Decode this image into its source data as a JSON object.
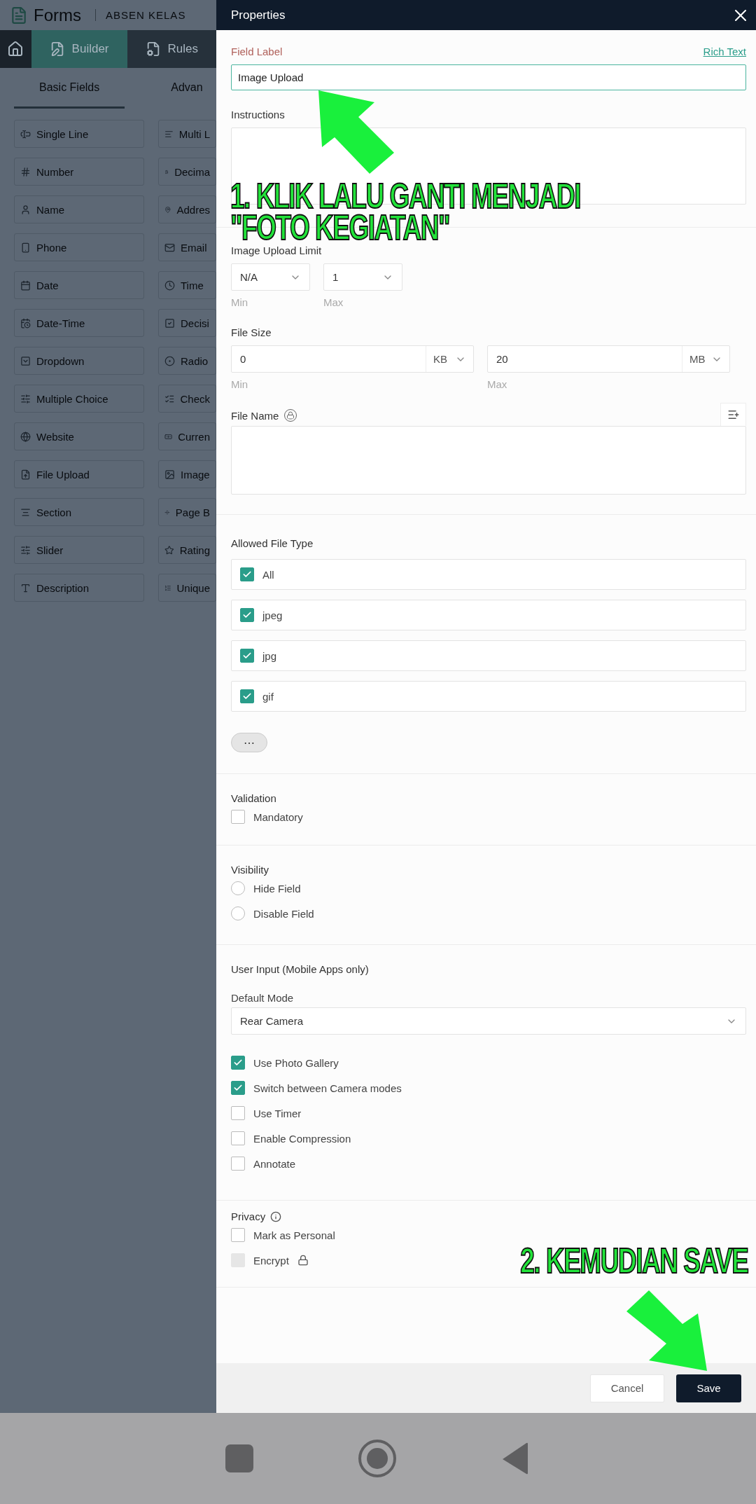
{
  "app_bar": {
    "title": "Forms",
    "form_name": "ABSEN KELAS"
  },
  "nav_tabs": [
    {
      "label": "Builder",
      "selected": true
    },
    {
      "label": "Rules",
      "selected": false
    }
  ],
  "field_tabs": [
    {
      "label": "Basic Fields",
      "selected": true
    },
    {
      "label": "Advan",
      "selected": false
    }
  ],
  "field_types": [
    {
      "label": "Single Line"
    },
    {
      "label": "Multi L"
    },
    {
      "label": "Number"
    },
    {
      "label": "Decima"
    },
    {
      "label": "Name"
    },
    {
      "label": "Addres"
    },
    {
      "label": "Phone"
    },
    {
      "label": "Email"
    },
    {
      "label": "Date"
    },
    {
      "label": "Time"
    },
    {
      "label": "Date-Time"
    },
    {
      "label": "Decisi"
    },
    {
      "label": "Dropdown"
    },
    {
      "label": "Radio"
    },
    {
      "label": "Multiple Choice"
    },
    {
      "label": "Check"
    },
    {
      "label": "Website"
    },
    {
      "label": "Curren"
    },
    {
      "label": "File Upload"
    },
    {
      "label": "Image"
    },
    {
      "label": "Section"
    },
    {
      "label": "Page B"
    },
    {
      "label": "Slider"
    },
    {
      "label": "Rating"
    },
    {
      "label": "Description"
    },
    {
      "label": "Unique"
    }
  ],
  "properties": {
    "title": "Properties",
    "field_label": {
      "label": "Field Label",
      "link": "Rich Text",
      "value": "Image Upload"
    },
    "instructions": {
      "label": "Instructions"
    },
    "upload_limit": {
      "label": "Image Upload Limit",
      "min": {
        "value": "N/A",
        "caption": "Min"
      },
      "max": {
        "value": "1",
        "caption": "Max"
      }
    },
    "file_size": {
      "label": "File Size",
      "min": {
        "value": "0",
        "unit": "KB",
        "caption": "Min"
      },
      "max": {
        "value": "20",
        "unit": "MB",
        "caption": "Max"
      }
    },
    "file_name": {
      "label": "File Name"
    },
    "allowed_types": {
      "label": "Allowed File Type",
      "more": "⋯",
      "items": [
        {
          "label": "All",
          "checked": true
        },
        {
          "label": "jpeg",
          "checked": true
        },
        {
          "label": "jpg",
          "checked": true
        },
        {
          "label": "gif",
          "checked": true
        }
      ]
    },
    "validation": {
      "label": "Validation",
      "items": [
        {
          "label": "Mandatory",
          "checked": false
        }
      ]
    },
    "visibility": {
      "label": "Visibility",
      "items": [
        {
          "label": "Hide Field",
          "checked": false
        },
        {
          "label": "Disable Field",
          "checked": false
        }
      ]
    },
    "user_input": {
      "label": "User Input (Mobile Apps only)",
      "default_mode": {
        "label": "Default Mode",
        "value": "Rear Camera"
      },
      "options": [
        {
          "label": "Use Photo Gallery",
          "checked": true
        },
        {
          "label": "Switch between Camera modes",
          "checked": true
        },
        {
          "label": "Use Timer",
          "checked": false
        },
        {
          "label": "Enable Compression",
          "checked": false
        },
        {
          "label": "Annotate",
          "checked": false
        }
      ]
    },
    "privacy": {
      "label": "Privacy",
      "items": [
        {
          "label": "Mark as Personal",
          "checked": false,
          "disabled": false
        },
        {
          "label": "Encrypt",
          "checked": false,
          "disabled": true
        }
      ]
    },
    "buttons": {
      "cancel": "Cancel",
      "save": "Save"
    }
  },
  "annotations": [
    {
      "lines": [
        "1. KLIK LALU GANTI MENJADI",
        "\"FOTO KEGIATAN\""
      ]
    },
    {
      "lines": [
        "2. KEMUDIAN SAVE"
      ]
    }
  ]
}
